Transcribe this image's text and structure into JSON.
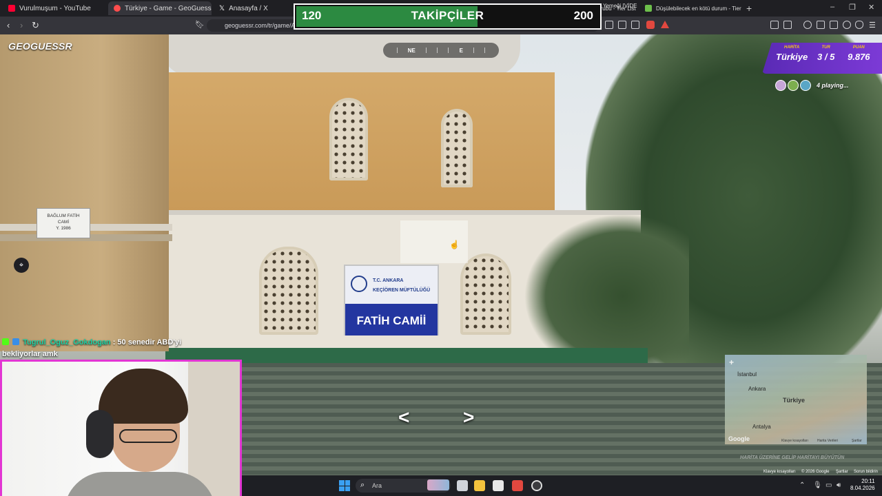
{
  "browser": {
    "tabs": [
      {
        "title": "Vurulmuşum - YouTube",
        "color": "#ff0033"
      },
      {
        "title": "Türkiye - Game - GeoGuessr",
        "color": "#ff4d4d"
      },
      {
        "title": "Anasayfa / X",
        "color": "#ffffff"
      },
      {
        "title": "Yemeği [VİDEOLU]",
        "color": "#888888"
      },
      {
        "title": "En İyi Türk Müzik Grubu - Tier List | K",
        "color": "#5e8bd6"
      },
      {
        "title": "Düşülebilecek en kötü durum - Tier L",
        "color": "#6dbf4b"
      }
    ],
    "new_tab": "+",
    "window_controls": {
      "minimize": "–",
      "maximize": "❐",
      "close": "✕"
    },
    "url": "geoguessr.com/tr/game/A"
  },
  "follower_goal": {
    "current": "120",
    "title": "TAKİPÇİLER",
    "target": "200",
    "fill_fraction": 0.6
  },
  "game": {
    "logo": "GEOGUESSR",
    "compass": {
      "left": "NE",
      "right": "E"
    },
    "hud": {
      "map_label": "HARİTA",
      "map_value": "Türkiye",
      "round_label": "TUR",
      "round_value": "3 / 5",
      "score_label": "PUAN",
      "score_value": "9.876"
    },
    "players_text": "4 playing...",
    "nav_left": "<",
    "nav_right": ">",
    "minimap": {
      "zoom": "+",
      "labels": {
        "istanbul": "İstanbul",
        "ankara": "Ankara",
        "turkiye": "Türkiye",
        "antalya": "Antalya"
      },
      "google": "Google",
      "footer_1": "Klavye kısayolları",
      "footer_2": "Harita Verileri",
      "footer_3": "Şartlar"
    },
    "map_hint": "HARİTA ÜZERİNE GELİP HARİTAYI BÜYÜTÜN",
    "attribution": {
      "shortcuts": "Klavye kısayolları",
      "copyright": "© 2026 Google",
      "terms": "Şartlar",
      "report": "Sorun bildirin"
    }
  },
  "scene": {
    "plaque_line1": "BAĞLUM FATİH",
    "plaque_line2": "CAMİ",
    "plaque_line3": "Y. 1986",
    "sign_line1": "T.C. ANKARA",
    "sign_line2": "KEÇİÖREN MÜFTÜLÜĞÜ",
    "sign_main": "FATİH CAMİİ"
  },
  "chat": {
    "user": "Tugrul_Oguz_Gokdogan",
    "message": ": 50 senedir ABD'yi bekliyorlar amk"
  },
  "taskbar": {
    "search_placeholder": "Ara",
    "time": "20:11",
    "date": "8.04.2026"
  }
}
